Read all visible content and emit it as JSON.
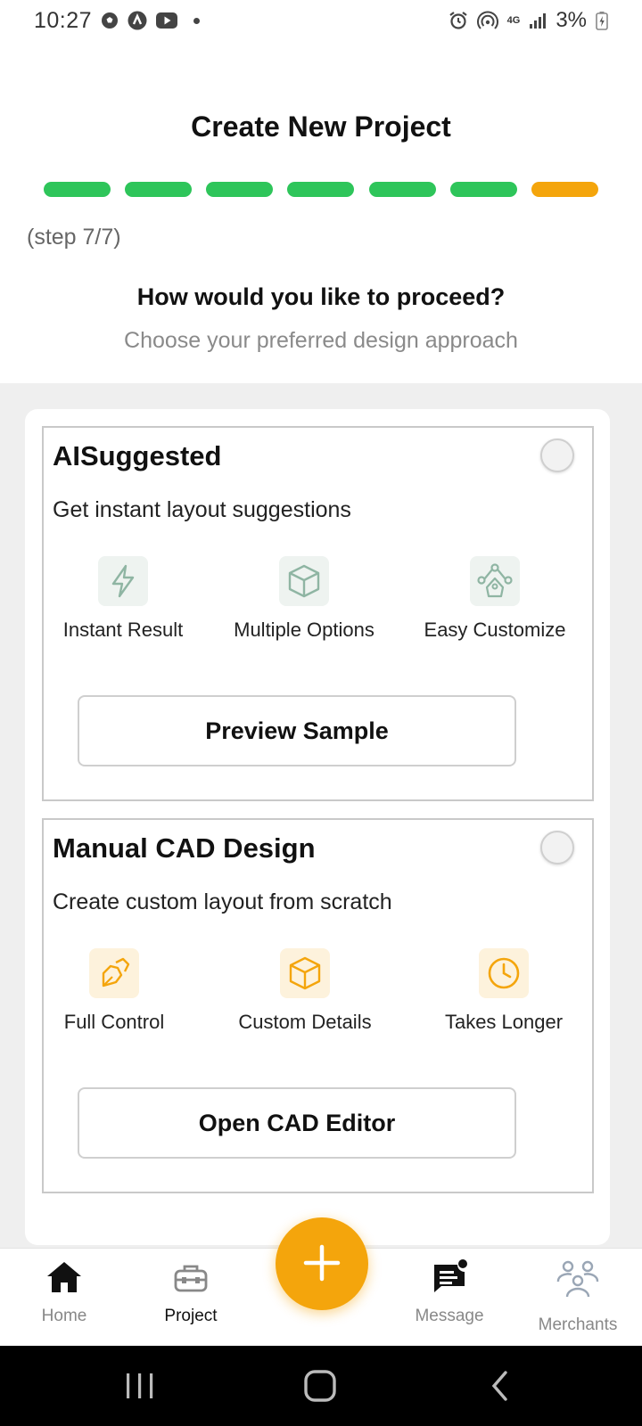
{
  "status_bar": {
    "time": "10:27",
    "network": "4G",
    "battery": "3%"
  },
  "header": {
    "title": "Create New Project",
    "step_label": "(step 7/7)",
    "progress": {
      "total_steps": 7,
      "current_step": 7,
      "completed_color": "#2ec55a",
      "current_color": "#f4a50c"
    },
    "question": "How would you like to proceed?",
    "subtitle": "Choose your preferred design approach"
  },
  "options": [
    {
      "title": "AISuggested",
      "description": "Get instant layout suggestions",
      "selected": false,
      "accent": "#8fb5a3",
      "features": [
        {
          "label": "Instant Result",
          "icon": "lightning-icon"
        },
        {
          "label": "Multiple Options",
          "icon": "cube-icon"
        },
        {
          "label": "Easy Customize",
          "icon": "pen-tool-icon"
        }
      ],
      "button_label": "Preview Sample"
    },
    {
      "title": "Manual CAD Design",
      "description": "Create custom layout from scratch",
      "selected": false,
      "accent": "#f4a50c",
      "features": [
        {
          "label": "Full Control",
          "icon": "edit-icon"
        },
        {
          "label": "Custom Details",
          "icon": "cube-icon"
        },
        {
          "label": "Takes Longer",
          "icon": "clock-icon"
        }
      ],
      "button_label": "Open CAD Editor"
    }
  ],
  "bottom_nav": {
    "items": [
      {
        "label": "Home",
        "icon": "home-icon"
      },
      {
        "label": "Project",
        "icon": "toolbox-icon",
        "active": true
      },
      {
        "label": "Message",
        "icon": "message-icon"
      },
      {
        "label": "Merchants",
        "icon": "people-icon"
      }
    ],
    "fab_icon": "plus-icon",
    "fab_color": "#f4a50c"
  }
}
